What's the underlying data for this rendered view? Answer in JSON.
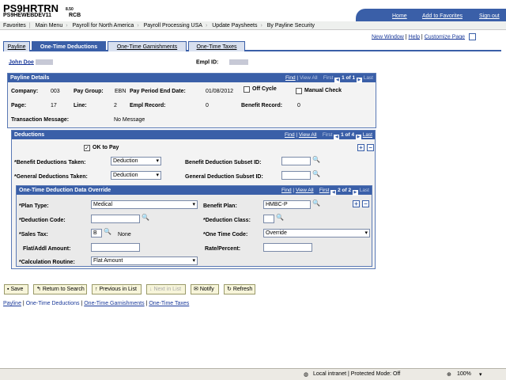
{
  "header": {
    "brand": "PS9HRTRN",
    "version": "8.50",
    "database": "PS9HEWEBDEV11",
    "database_suffix": "RCB",
    "links": [
      "Home",
      "Add to Favorites",
      "Sign out"
    ]
  },
  "breadcrumb": [
    "Favorites",
    "Main Menu",
    "Payroll for North America",
    "Payroll Processing USA",
    "Update Paysheets",
    "By Payline Security"
  ],
  "toolbar": {
    "new_window": "New Window",
    "help": "Help",
    "customize": "Customize Page"
  },
  "tabs": [
    "Payline",
    "One-Time Deductions",
    "One-Time Garnishments",
    "One-Time Taxes"
  ],
  "employee": {
    "name": "John Doe",
    "emplid_label": "Empl ID:"
  },
  "payline": {
    "title": "Payline Details",
    "nav": {
      "find": "Find",
      "view_all": "View All",
      "first": "First",
      "count": "1 of 1",
      "last": "Last"
    },
    "company_label": "Company:",
    "company": "003",
    "paygroup_label": "Pay Group:",
    "paygroup": "EBN",
    "ped_label": "Pay Period End Date:",
    "ped": "01/08/2012",
    "offcycle": "Off Cycle",
    "manual_check": "Manual Check",
    "page_label": "Page:",
    "page": "17",
    "line_label": "Line:",
    "line": "2",
    "empl_record_label": "Empl Record:",
    "empl_record": "0",
    "benefit_record_label": "Benefit Record:",
    "benefit_record": "0",
    "txn_label": "Transaction Message:",
    "txn": "No Message"
  },
  "deductions": {
    "title": "Deductions",
    "nav": {
      "find": "Find",
      "view_all": "View All",
      "first": "First",
      "count": "1 of 4",
      "last": "Last"
    },
    "ok_to_pay": "OK to Pay",
    "benefit_taken_label": "*Benefit Deductions Taken:",
    "benefit_taken": "Deduction",
    "general_taken_label": "*General Deductions Taken:",
    "general_taken": "Deduction",
    "benefit_subset_label": "Benefit Deduction Subset ID:",
    "general_subset_label": "General Deduction Subset ID:"
  },
  "override": {
    "title": "One-Time Deduction Data Override",
    "nav": {
      "find": "Find",
      "view_all": "View All",
      "first": "First",
      "count": "2 of 2",
      "last": "Last"
    },
    "plan_type_label": "*Plan Type:",
    "plan_type": "Medical",
    "benefit_plan_label": "Benefit Plan:",
    "benefit_plan": "HMBC-P",
    "ded_code_label": "*Deduction Code:",
    "ded_class_label": "*Deduction Class:",
    "sales_tax_label": "*Sales Tax:",
    "sales_tax": "B",
    "sales_tax_desc": "None",
    "one_time_code_label": "*One Time Code:",
    "one_time_code": "Override",
    "flat_label": "Flat/Addl Amount:",
    "rate_label": "Rate/Percent:",
    "calc_label": "*Calculation Routine:",
    "calc": "Flat Amount"
  },
  "buttons": [
    "Save",
    "Return to Search",
    "Previous in List",
    "Next in List",
    "Notify",
    "Refresh"
  ],
  "footer_links": [
    "Payline",
    "One-Time Deductions",
    "One-Time Garnishments",
    "One-Time Taxes"
  ],
  "status": {
    "zone": "Local intranet | Protected Mode: Off",
    "zoom": "100%"
  }
}
